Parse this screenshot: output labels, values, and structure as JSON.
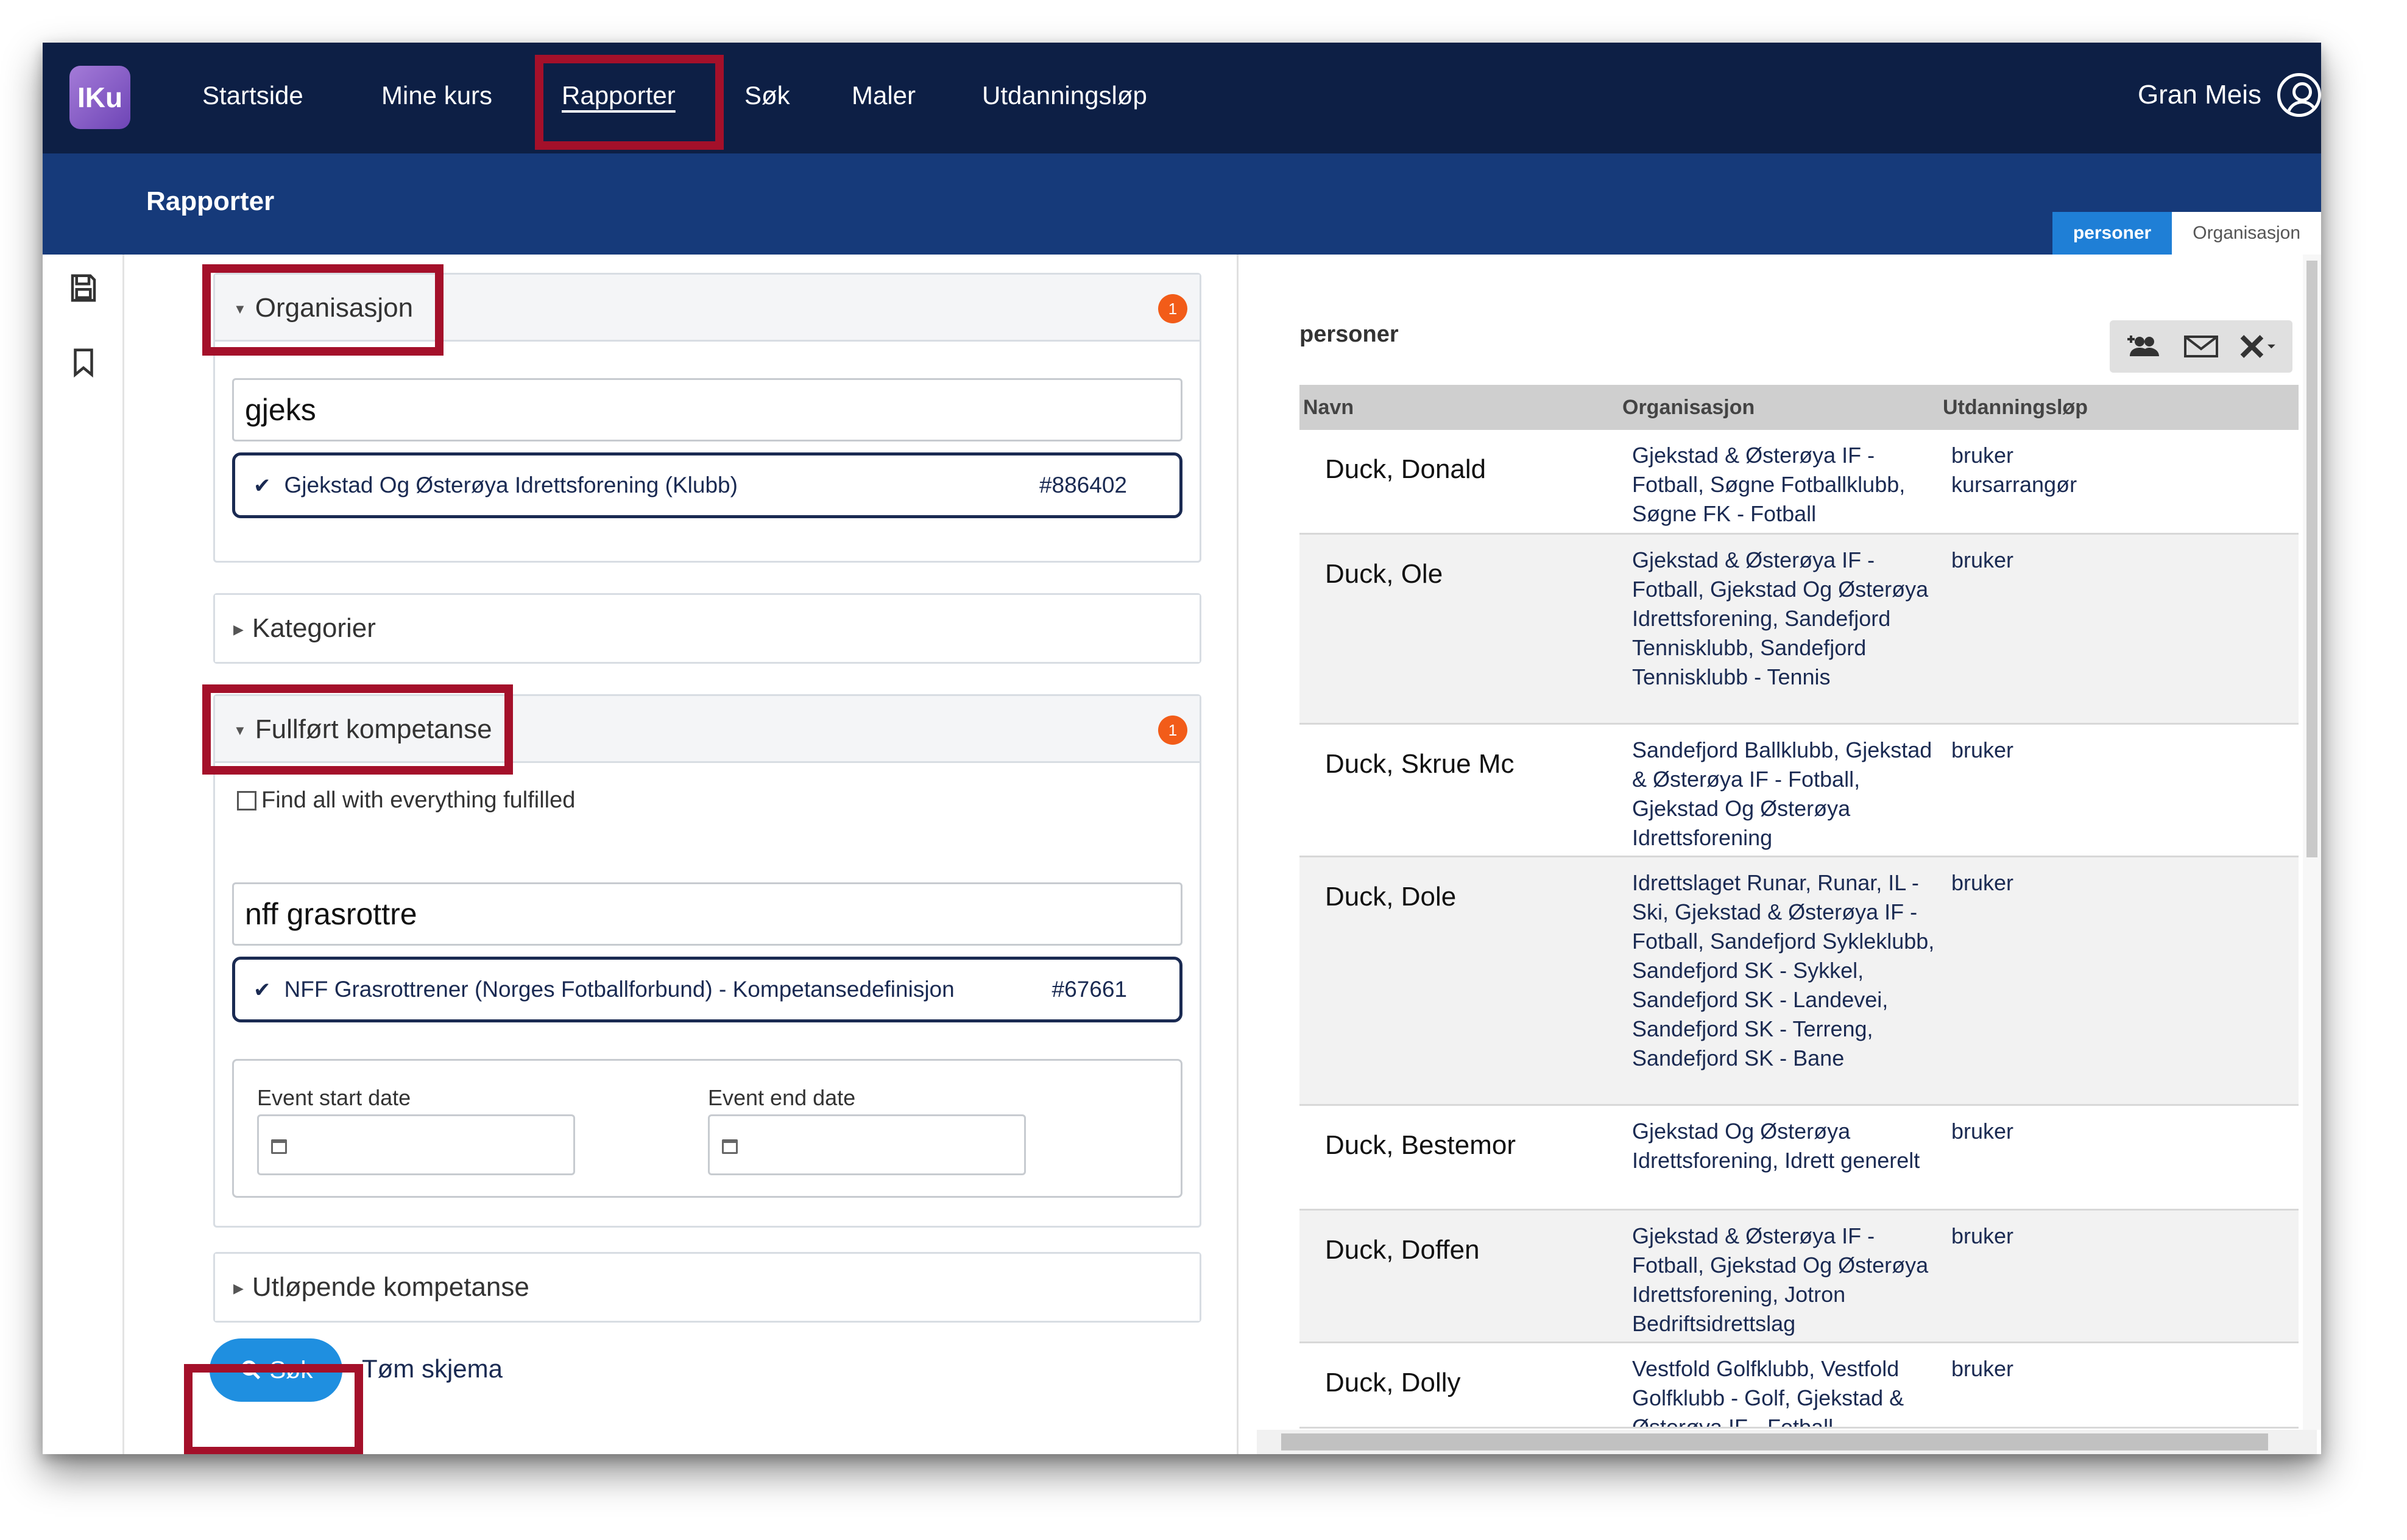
{
  "app": {
    "logo_text": "IKu",
    "nav": [
      "Startside",
      "Mine kurs",
      "Rapporter",
      "Søk",
      "Maler",
      "Utdanningsløp"
    ],
    "active_nav": "Rapporter",
    "user_name": "Gran Meis"
  },
  "page": {
    "title": "Rapporter",
    "view_tabs": [
      "personer",
      "Organisasjon"
    ],
    "active_view_tab": "personer"
  },
  "filters": {
    "organisasjon": {
      "title": "Organisasjon",
      "badge": "1",
      "query": "gjeks",
      "selected_label": "Gjekstad Og Østerøya Idrettsforening (Klubb)",
      "selected_id": "#886402"
    },
    "kategorier": {
      "title": "Kategorier"
    },
    "fullfort": {
      "title": "Fullført kompetanse",
      "badge": "1",
      "checkbox_label": "Find all with everything fulfilled",
      "query": "nff grasrottre",
      "selected_label": "NFF Grasrottrener (Norges Fotballforbund) - Kompetansedefinisjon",
      "selected_id": "#67661",
      "start_label": "Event start date",
      "end_label": "Event end date"
    },
    "utlopende": {
      "title": "Utløpende kompetanse"
    },
    "search_label": "Søk",
    "clear_label": "Tøm skjema"
  },
  "results": {
    "title": "personer",
    "columns": [
      "Navn",
      "Organisasjon",
      "Utdanningsløp"
    ],
    "rows": [
      {
        "name": "Duck, Donald",
        "org": "Gjekstad & Østerøya IF - Fotball, Søgne Fotballklubb, Søgne FK - Fotball",
        "edu": "bruker\nkursarrangør"
      },
      {
        "name": "Duck, Ole",
        "org": "Gjekstad & Østerøya IF - Fotball, Gjekstad Og Østerøya Idrettsforening, Sandefjord Tennisklubb, Sandefjord Tennisklubb - Tennis",
        "edu": "bruker"
      },
      {
        "name": "Duck, Skrue Mc",
        "org": "Sandefjord Ballklubb, Gjekstad & Østerøya IF - Fotball, Gjekstad Og Østerøya Idrettsforening",
        "edu": "bruker"
      },
      {
        "name": "Duck, Dole",
        "org": "Idrettslaget Runar, Runar, IL - Ski, Gjekstad & Østerøya IF - Fotball, Sandefjord Sykleklubb, Sandefjord SK - Sykkel, Sandefjord SK - Landevei, Sandefjord SK - Terreng, Sandefjord SK - Bane",
        "edu": "bruker"
      },
      {
        "name": "Duck, Bestemor",
        "org": "Gjekstad Og Østerøya Idrettsforening, Idrett generelt",
        "edu": "bruker"
      },
      {
        "name": "Duck, Doffen",
        "org": "Gjekstad & Østerøya IF - Fotball, Gjekstad Og Østerøya Idrettsforening, Jotron Bedriftsidrettslag",
        "edu": "bruker"
      },
      {
        "name": "Duck, Dolly",
        "org": "Vestfold Golfklubb, Vestfold Golfklubb - Golf, Gjekstad & Østerøya IF - Fotball",
        "edu": "bruker"
      }
    ]
  },
  "colors": {
    "nav_bg": "#0d1f45",
    "subheader_bg": "#163a7a",
    "accent": "#1f8fe0",
    "highlight": "#a4102a",
    "badge": "#f25c19"
  }
}
